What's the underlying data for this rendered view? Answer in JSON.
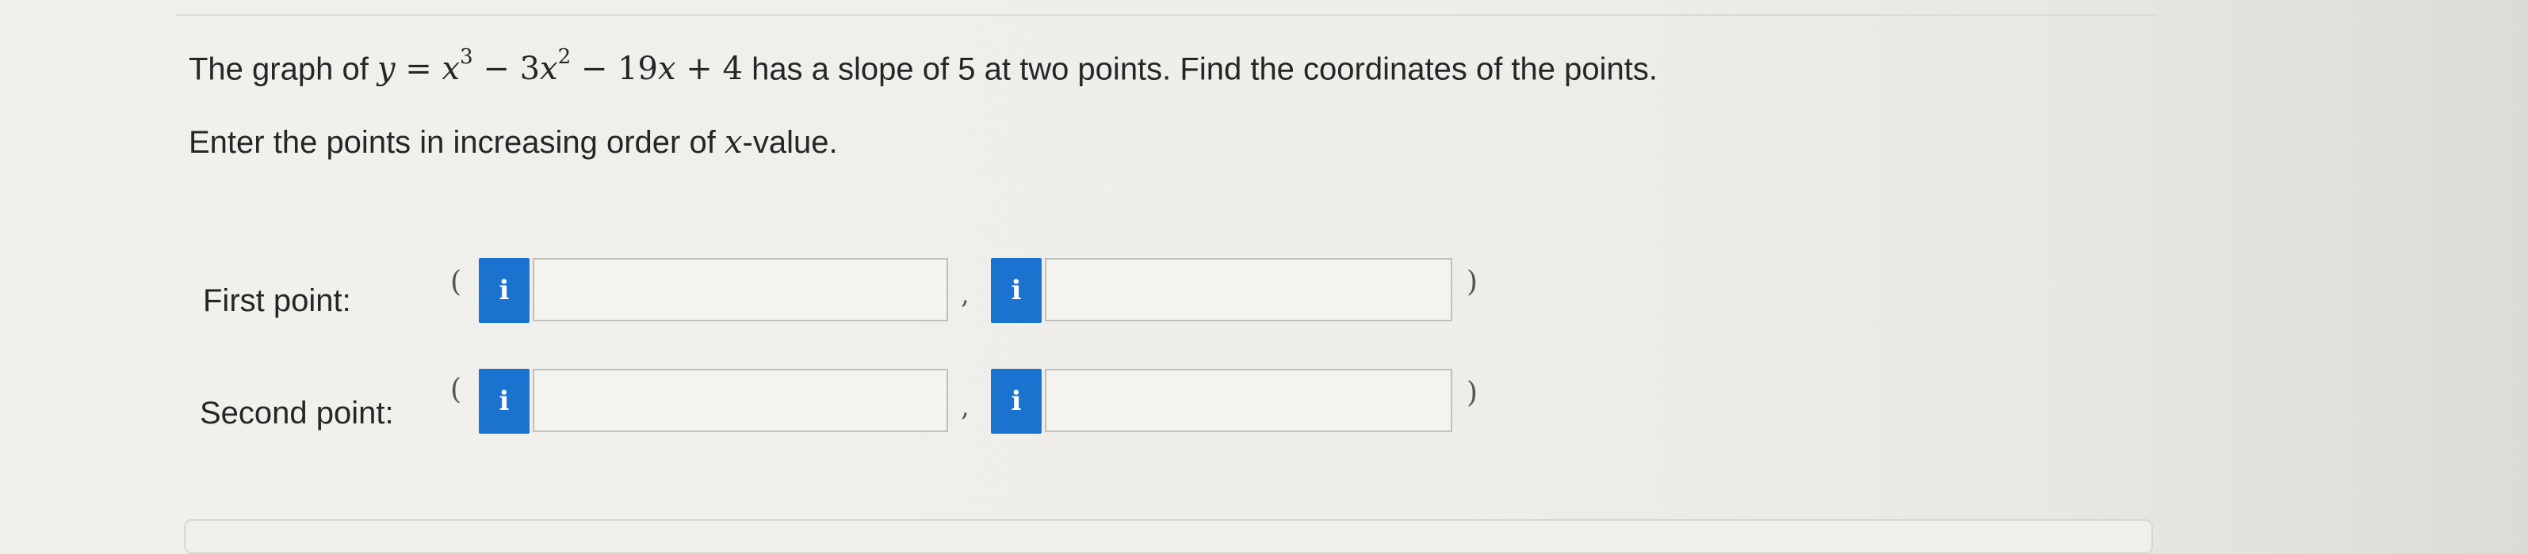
{
  "question": {
    "prefix": "The graph of ",
    "equation": {
      "lhs": "y",
      "equals": " = ",
      "t1_var": "x",
      "t1_exp": "3",
      "op1": " − ",
      "t2_coef": "3",
      "t2_var": "x",
      "t2_exp": "2",
      "op2": " − ",
      "t3_coef": "19",
      "t3_var": "x",
      "op3": " + ",
      "t4": "4"
    },
    "suffix": " has a slope of 5 at two points. Find the coordinates of the points."
  },
  "instruction": {
    "prefix": "Enter the points in increasing order of ",
    "var": "x",
    "suffix": "-value."
  },
  "rows": [
    {
      "label": "First point:",
      "open_paren": "(",
      "comma": ",",
      "close_paren": ")",
      "x_value": "",
      "y_value": "",
      "info_symbol": "i"
    },
    {
      "label": "Second point:",
      "open_paren": "(",
      "comma": ",",
      "close_paren": ")",
      "x_value": "",
      "y_value": "",
      "info_symbol": "i"
    }
  ],
  "colors": {
    "info_button": "#1a74cf",
    "background": "#f1f0ec",
    "field_border": "#bfbfbb"
  }
}
